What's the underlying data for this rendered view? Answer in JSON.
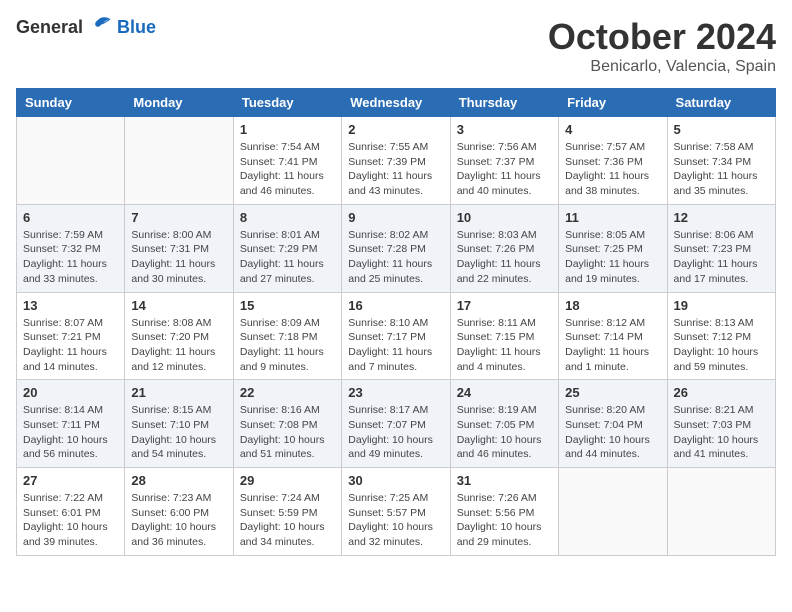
{
  "header": {
    "logo_general": "General",
    "logo_blue": "Blue",
    "month_title": "October 2024",
    "location": "Benicarlo, Valencia, Spain"
  },
  "weekdays": [
    "Sunday",
    "Monday",
    "Tuesday",
    "Wednesday",
    "Thursday",
    "Friday",
    "Saturday"
  ],
  "weeks": [
    [
      {
        "day": "",
        "info": ""
      },
      {
        "day": "",
        "info": ""
      },
      {
        "day": "1",
        "info": "Sunrise: 7:54 AM\nSunset: 7:41 PM\nDaylight: 11 hours and 46 minutes."
      },
      {
        "day": "2",
        "info": "Sunrise: 7:55 AM\nSunset: 7:39 PM\nDaylight: 11 hours and 43 minutes."
      },
      {
        "day": "3",
        "info": "Sunrise: 7:56 AM\nSunset: 7:37 PM\nDaylight: 11 hours and 40 minutes."
      },
      {
        "day": "4",
        "info": "Sunrise: 7:57 AM\nSunset: 7:36 PM\nDaylight: 11 hours and 38 minutes."
      },
      {
        "day": "5",
        "info": "Sunrise: 7:58 AM\nSunset: 7:34 PM\nDaylight: 11 hours and 35 minutes."
      }
    ],
    [
      {
        "day": "6",
        "info": "Sunrise: 7:59 AM\nSunset: 7:32 PM\nDaylight: 11 hours and 33 minutes."
      },
      {
        "day": "7",
        "info": "Sunrise: 8:00 AM\nSunset: 7:31 PM\nDaylight: 11 hours and 30 minutes."
      },
      {
        "day": "8",
        "info": "Sunrise: 8:01 AM\nSunset: 7:29 PM\nDaylight: 11 hours and 27 minutes."
      },
      {
        "day": "9",
        "info": "Sunrise: 8:02 AM\nSunset: 7:28 PM\nDaylight: 11 hours and 25 minutes."
      },
      {
        "day": "10",
        "info": "Sunrise: 8:03 AM\nSunset: 7:26 PM\nDaylight: 11 hours and 22 minutes."
      },
      {
        "day": "11",
        "info": "Sunrise: 8:05 AM\nSunset: 7:25 PM\nDaylight: 11 hours and 19 minutes."
      },
      {
        "day": "12",
        "info": "Sunrise: 8:06 AM\nSunset: 7:23 PM\nDaylight: 11 hours and 17 minutes."
      }
    ],
    [
      {
        "day": "13",
        "info": "Sunrise: 8:07 AM\nSunset: 7:21 PM\nDaylight: 11 hours and 14 minutes."
      },
      {
        "day": "14",
        "info": "Sunrise: 8:08 AM\nSunset: 7:20 PM\nDaylight: 11 hours and 12 minutes."
      },
      {
        "day": "15",
        "info": "Sunrise: 8:09 AM\nSunset: 7:18 PM\nDaylight: 11 hours and 9 minutes."
      },
      {
        "day": "16",
        "info": "Sunrise: 8:10 AM\nSunset: 7:17 PM\nDaylight: 11 hours and 7 minutes."
      },
      {
        "day": "17",
        "info": "Sunrise: 8:11 AM\nSunset: 7:15 PM\nDaylight: 11 hours and 4 minutes."
      },
      {
        "day": "18",
        "info": "Sunrise: 8:12 AM\nSunset: 7:14 PM\nDaylight: 11 hours and 1 minute."
      },
      {
        "day": "19",
        "info": "Sunrise: 8:13 AM\nSunset: 7:12 PM\nDaylight: 10 hours and 59 minutes."
      }
    ],
    [
      {
        "day": "20",
        "info": "Sunrise: 8:14 AM\nSunset: 7:11 PM\nDaylight: 10 hours and 56 minutes."
      },
      {
        "day": "21",
        "info": "Sunrise: 8:15 AM\nSunset: 7:10 PM\nDaylight: 10 hours and 54 minutes."
      },
      {
        "day": "22",
        "info": "Sunrise: 8:16 AM\nSunset: 7:08 PM\nDaylight: 10 hours and 51 minutes."
      },
      {
        "day": "23",
        "info": "Sunrise: 8:17 AM\nSunset: 7:07 PM\nDaylight: 10 hours and 49 minutes."
      },
      {
        "day": "24",
        "info": "Sunrise: 8:19 AM\nSunset: 7:05 PM\nDaylight: 10 hours and 46 minutes."
      },
      {
        "day": "25",
        "info": "Sunrise: 8:20 AM\nSunset: 7:04 PM\nDaylight: 10 hours and 44 minutes."
      },
      {
        "day": "26",
        "info": "Sunrise: 8:21 AM\nSunset: 7:03 PM\nDaylight: 10 hours and 41 minutes."
      }
    ],
    [
      {
        "day": "27",
        "info": "Sunrise: 7:22 AM\nSunset: 6:01 PM\nDaylight: 10 hours and 39 minutes."
      },
      {
        "day": "28",
        "info": "Sunrise: 7:23 AM\nSunset: 6:00 PM\nDaylight: 10 hours and 36 minutes."
      },
      {
        "day": "29",
        "info": "Sunrise: 7:24 AM\nSunset: 5:59 PM\nDaylight: 10 hours and 34 minutes."
      },
      {
        "day": "30",
        "info": "Sunrise: 7:25 AM\nSunset: 5:57 PM\nDaylight: 10 hours and 32 minutes."
      },
      {
        "day": "31",
        "info": "Sunrise: 7:26 AM\nSunset: 5:56 PM\nDaylight: 10 hours and 29 minutes."
      },
      {
        "day": "",
        "info": ""
      },
      {
        "day": "",
        "info": ""
      }
    ]
  ]
}
